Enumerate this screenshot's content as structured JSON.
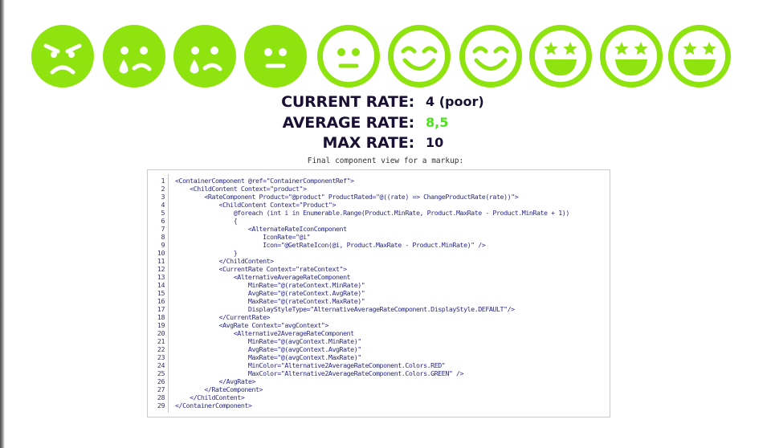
{
  "colors": {
    "icon_green": "#8fe30f",
    "text_dark": "#1a1033",
    "average_green": "#4be31a",
    "code_text": "#2a2a8a"
  },
  "rating": {
    "icons": [
      {
        "name": "angry-face-icon"
      },
      {
        "name": "crying-face-icon"
      },
      {
        "name": "crying-face-icon"
      },
      {
        "name": "neutral-face-icon"
      },
      {
        "name": "neutral-face-outline-icon"
      },
      {
        "name": "smiling-face-icon"
      },
      {
        "name": "smiling-face-icon"
      },
      {
        "name": "star-eyes-face-icon"
      },
      {
        "name": "star-eyes-face-icon"
      },
      {
        "name": "star-eyes-face-icon"
      }
    ],
    "filled_count": 4,
    "max": 10
  },
  "stats": {
    "current_label": "CURRENT RATE:",
    "current_value": "4 (poor)",
    "average_label": "AVERAGE RATE:",
    "average_value": "8,5",
    "max_label": "MAX RATE:",
    "max_value": "10"
  },
  "caption": "Final component view for a markup:",
  "code": [
    {
      "n": "1",
      "t": "<ContainerComponent @ref=\"ContainerComponentRef\">"
    },
    {
      "n": "2",
      "t": "    <ChildContent Context=\"product\">"
    },
    {
      "n": "3",
      "t": "        <RateComponent Product=\"@product\" ProductRated=\"@((rate) => ChangeProductRate(rate))\">"
    },
    {
      "n": "4",
      "t": "            <ChildContent Context=\"Product\">"
    },
    {
      "n": "5",
      "t": "                @foreach (int i in Enumerable.Range(Product.MinRate, Product.MaxRate - Product.MinRate + 1))"
    },
    {
      "n": "6",
      "t": "                {"
    },
    {
      "n": "7",
      "t": "                    <AlternateRateIconComponent"
    },
    {
      "n": "8",
      "t": "                        IconRate=\"@i\""
    },
    {
      "n": "9",
      "t": "                        Icon=\"@GetRateIcon(@i, Product.MaxRate - Product.MinRate)\" />"
    },
    {
      "n": "10",
      "t": "                }"
    },
    {
      "n": "11",
      "t": "            </ChildContent>"
    },
    {
      "n": "12",
      "t": "            <CurrentRate Context=\"rateContext\">"
    },
    {
      "n": "13",
      "t": "                <AlternativeAverageRateComponent"
    },
    {
      "n": "14",
      "t": "                    MinRate=\"@(rateContext.MinRate)\""
    },
    {
      "n": "15",
      "t": "                    AvgRate=\"@(rateContext.AvgRate)\""
    },
    {
      "n": "16",
      "t": "                    MaxRate=\"@(rateContext.MaxRate)\""
    },
    {
      "n": "17",
      "t": "                    DisplayStyleType=\"AlternativeAverageRateComponent.DisplayStyle.DEFAULT\"/>"
    },
    {
      "n": "18",
      "t": "            </CurrentRate>"
    },
    {
      "n": "19",
      "t": "            <AvgRate Context=\"avgContext\">"
    },
    {
      "n": "20",
      "t": "                <Alternative2AverageRateComponent"
    },
    {
      "n": "21",
      "t": "                    MinRate=\"@(avgContext.MinRate)\""
    },
    {
      "n": "22",
      "t": "                    AvgRate=\"@(avgContext.AvgRate)\""
    },
    {
      "n": "23",
      "t": "                    MaxRate=\"@(avgContext.MaxRate)\""
    },
    {
      "n": "24",
      "t": "                    MinColor=\"Alternative2AverageRateComponent.Colors.RED\""
    },
    {
      "n": "25",
      "t": "                    MaxColor=\"Alternative2AverageRateComponent.Colors.GREEN\" />"
    },
    {
      "n": "26",
      "t": "            </AvgRate>"
    },
    {
      "n": "27",
      "t": "        </RateComponent>"
    },
    {
      "n": "28",
      "t": "    </ChildContent>"
    },
    {
      "n": "29",
      "t": "</ContainerComponent>"
    }
  ]
}
